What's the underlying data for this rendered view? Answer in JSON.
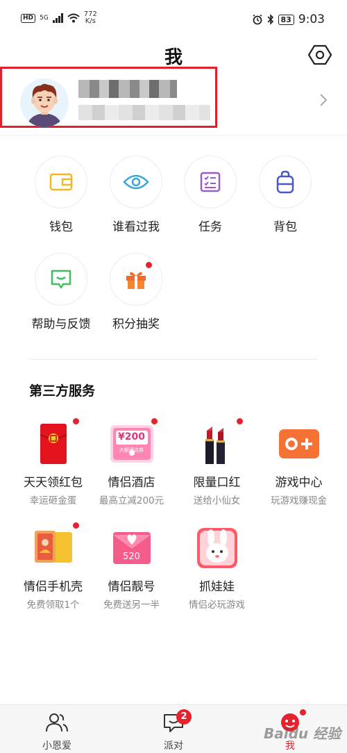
{
  "status_bar": {
    "hd": "HD",
    "signal": "5G",
    "speed_value": "772",
    "speed_unit": "K/s",
    "battery": "83",
    "time": "9:03"
  },
  "header": {
    "title": "我"
  },
  "quick_tiles": [
    {
      "label": "钱包",
      "icon": "wallet-icon"
    },
    {
      "label": "谁看过我",
      "icon": "eye-icon"
    },
    {
      "label": "任务",
      "icon": "checklist-icon"
    },
    {
      "label": "背包",
      "icon": "backpack-icon"
    },
    {
      "label": "帮助与反馈",
      "icon": "feedback-icon"
    },
    {
      "label": "积分抽奖",
      "icon": "gift-icon",
      "has_dot": true
    }
  ],
  "third_party": {
    "title": "第三方服务",
    "items": [
      {
        "name": "天天领红包",
        "sub": "幸运砸金蛋",
        "icon": "red-envelope-icon",
        "has_dot": true
      },
      {
        "name": "情侣酒店",
        "sub": "最高立减200元",
        "icon": "hotel-coupon-icon",
        "has_dot": true,
        "badge_amount": "¥200",
        "badge_caption": "大额酒店券"
      },
      {
        "name": "限量口红",
        "sub": "送给小仙女",
        "icon": "lipstick-icon",
        "has_dot": true
      },
      {
        "name": "游戏中心",
        "sub": "玩游戏赚现金",
        "icon": "gamepad-icon",
        "has_dot": false
      },
      {
        "name": "情侣手机壳",
        "sub": "免费领取1个",
        "icon": "phone-case-icon",
        "has_dot": true
      },
      {
        "name": "情侣靓号",
        "sub": "免费送另一半",
        "icon": "couple-number-icon",
        "has_dot": false,
        "badge_amount": "520"
      },
      {
        "name": "抓娃娃",
        "sub": "情侣必玩游戏",
        "icon": "claw-machine-icon",
        "has_dot": false
      }
    ]
  },
  "bottom_nav": [
    {
      "label": "小恩爱",
      "icon": "people-icon"
    },
    {
      "label": "派对",
      "icon": "chat-bubble-icon",
      "badge": "2"
    },
    {
      "label": "我",
      "icon": "me-icon",
      "active": true
    }
  ],
  "watermark": "Baidu 经验",
  "colors": {
    "accent": "#e5222d",
    "profile_highlight": "#e0202a"
  }
}
